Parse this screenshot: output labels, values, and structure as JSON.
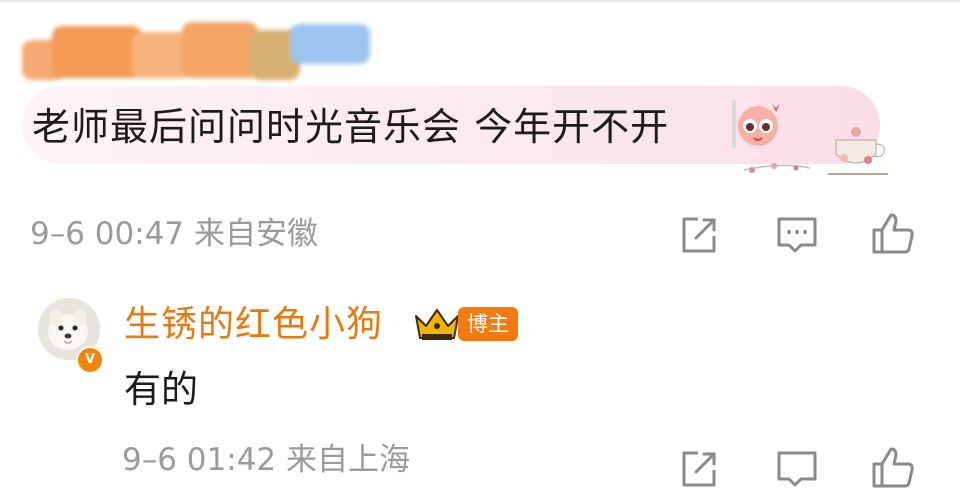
{
  "comment": {
    "text": "老师最后问问时光音乐会 今年开不开",
    "meta": "9–6 00:47 来自安徽"
  },
  "reply": {
    "username": "生锈的红色小狗",
    "badge": "博主",
    "text": "有的",
    "meta": "9–6 01:42 来自上海"
  },
  "icons": {
    "share": "share-icon",
    "comment": "comment-icon",
    "like": "like-icon"
  },
  "colors": {
    "username": "#e8790e",
    "badge": "#f77a0f",
    "meta": "#9a9a9a",
    "text": "#1b1b1b"
  }
}
